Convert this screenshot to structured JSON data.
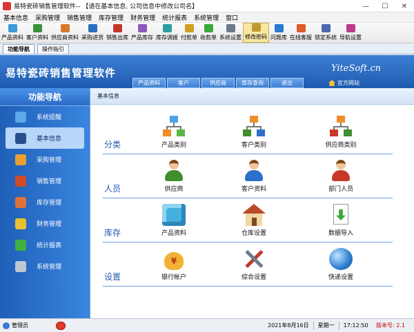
{
  "window": {
    "title": "易特瓷砖销售管理软件-- 【请在基本信息, 公司信息中修改公司名】",
    "min_glyph": "—",
    "max_glyph": "☐",
    "close_glyph": "✕"
  },
  "menu": [
    "基本信息",
    "采购管理",
    "销售管理",
    "库存管理",
    "财务管理",
    "统计报表",
    "系统管理",
    "窗口"
  ],
  "toolbar": [
    {
      "label": "产品资料",
      "icon": "box-icon",
      "color": "#3a9bd8"
    },
    {
      "label": "客户资料",
      "icon": "users-icon",
      "color": "#3c8f3c"
    },
    {
      "label": "供应商资料",
      "icon": "supplier-icon",
      "color": "#d8782a"
    },
    {
      "label": "采购进货",
      "icon": "cart-icon",
      "color": "#2a6ec0"
    },
    {
      "label": "销售出库",
      "icon": "truck-icon",
      "color": "#c03a2a"
    },
    {
      "label": "产品库存",
      "icon": "warehouse-icon",
      "color": "#8a5ac0"
    },
    {
      "label": "库存调拨",
      "icon": "transfer-icon",
      "color": "#2aa0a0"
    },
    {
      "label": "付款单",
      "icon": "payment-icon",
      "color": "#d0a020"
    },
    {
      "label": "收款单",
      "icon": "receipt-icon",
      "color": "#3aa83a"
    },
    {
      "label": "系统设置",
      "icon": "settings-icon",
      "color": "#6a7a8a"
    },
    {
      "label": "修改密码",
      "icon": "key-icon",
      "color": "#c09a30"
    },
    {
      "label": "问题库",
      "icon": "help-icon",
      "color": "#2a7ad0"
    },
    {
      "label": "在线客服",
      "icon": "chat-icon",
      "color": "#e05a2a"
    },
    {
      "label": "锁定系统",
      "icon": "lock-icon",
      "color": "#4a6ab0"
    },
    {
      "label": "导航设置",
      "icon": "nav-icon",
      "color": "#c03a8a"
    }
  ],
  "toolbar_active": "修改密码",
  "doc_tabs": [
    "功能导航",
    "操作指引"
  ],
  "banner": {
    "title": "易特瓷砖销售管理软件",
    "brand": "YiteSoft.cn",
    "tabs": [
      "产品资料",
      "客户",
      "供应商",
      "库存查询",
      "退出"
    ],
    "site": "官方网站"
  },
  "sidebar": {
    "header": "功能导航",
    "items": [
      {
        "label": "系统提醒",
        "icon": "info-icon",
        "color": "#5fa8e8"
      },
      {
        "label": "基本信息",
        "icon": "disk-icon",
        "color": "#2a4f8f"
      },
      {
        "label": "采购管理",
        "icon": "purchase-icon",
        "color": "#e8a030"
      },
      {
        "label": "销售管理",
        "icon": "sales-icon",
        "color": "#d04a2a"
      },
      {
        "label": "库存管理",
        "icon": "stock-icon",
        "color": "#e0703a"
      },
      {
        "label": "财务管理",
        "icon": "finance-icon",
        "color": "#e8c030"
      },
      {
        "label": "统计报表",
        "icon": "chart-icon",
        "color": "#40b040"
      },
      {
        "label": "系统管理",
        "icon": "tools-icon",
        "color": "#c0c8d0"
      }
    ],
    "selected": "基本信息"
  },
  "content": {
    "header": "基本信息",
    "rows": [
      {
        "label": "分类",
        "items": [
          {
            "label": "产品类别",
            "icon": "category-tree-icon"
          },
          {
            "label": "客户类别",
            "icon": "customer-tree-icon"
          },
          {
            "label": "供应商类别",
            "icon": "supplier-tree-icon"
          }
        ]
      },
      {
        "label": "人员",
        "items": [
          {
            "label": "供应商",
            "icon": "supplier-person-icon"
          },
          {
            "label": "客户资料",
            "icon": "customer-people-icon"
          },
          {
            "label": "部门人员",
            "icon": "staff-icon"
          }
        ]
      },
      {
        "label": "库存",
        "items": [
          {
            "label": "产品资料",
            "icon": "product-cube-icon"
          },
          {
            "label": "仓库设置",
            "icon": "warehouse-house-icon"
          },
          {
            "label": "数据导入",
            "icon": "import-icon"
          }
        ]
      },
      {
        "label": "设置",
        "items": [
          {
            "label": "银行帐户",
            "icon": "money-bag-icon"
          },
          {
            "label": "综合设置",
            "icon": "tools-settings-icon"
          },
          {
            "label": "快递设置",
            "icon": "globe-icon"
          }
        ]
      }
    ]
  },
  "status": {
    "user": "管理员",
    "date": "2021年8月16日",
    "weekday": "星期一",
    "time": "17:12:50",
    "version": "版本号: 2.1"
  }
}
